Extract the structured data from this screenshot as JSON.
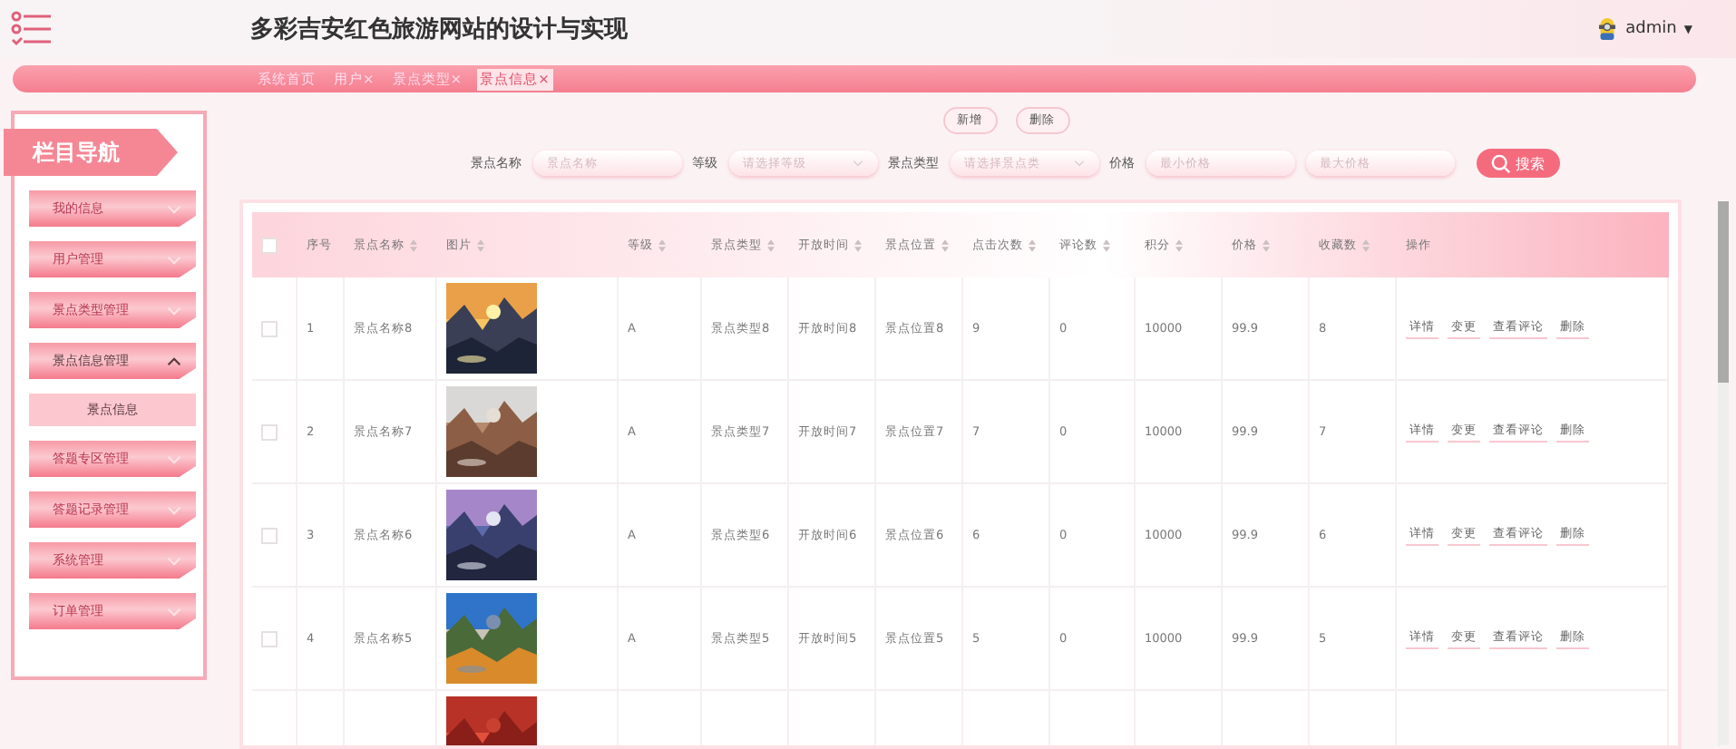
{
  "header": {
    "title": "多彩吉安红色旅游网站的设计与实现",
    "user": "admin",
    "caret": "▼"
  },
  "tabs": [
    {
      "label": "系统首页",
      "selected": false
    },
    {
      "label": "用户",
      "close": "×",
      "selected": false
    },
    {
      "label": "景点类型",
      "close": "×",
      "selected": false
    },
    {
      "label": "景点信息",
      "close": "×",
      "selected": true
    }
  ],
  "sidebar": {
    "title": "栏目导航",
    "items": [
      {
        "label": "我的信息",
        "expanded": false
      },
      {
        "label": "用户管理",
        "expanded": false
      },
      {
        "label": "景点类型管理",
        "expanded": false
      },
      {
        "label": "景点信息管理",
        "expanded": true,
        "children": [
          {
            "label": "景点信息",
            "selected": true
          }
        ]
      },
      {
        "label": "答题专区管理",
        "expanded": false
      },
      {
        "label": "答题记录管理",
        "expanded": false
      },
      {
        "label": "系统管理",
        "expanded": false
      },
      {
        "label": "订单管理",
        "expanded": false
      }
    ]
  },
  "actions": [
    "新增",
    "删除"
  ],
  "filters": [
    {
      "kind": "text",
      "label": "景点名称",
      "placeholder": "景点名称"
    },
    {
      "kind": "select",
      "label": "等级",
      "placeholder": "请选择等级"
    },
    {
      "kind": "select",
      "label": "景点类型",
      "placeholder": "请选择景点类"
    },
    {
      "kind": "text",
      "label": "价格",
      "placeholder": "最小价格"
    },
    {
      "kind": "text",
      "placeholder": "最大价格"
    }
  ],
  "search_button": "搜索",
  "table": {
    "all_checked": false,
    "columns": [
      {
        "label": "序号",
        "sortable": false
      },
      {
        "label": "景点名称",
        "sortable": true
      },
      {
        "label": "图片",
        "sortable": true
      },
      {
        "label": "等级",
        "sortable": true
      },
      {
        "label": "景点类型",
        "sortable": true
      },
      {
        "label": "开放时间",
        "sortable": true
      },
      {
        "label": "景点位置",
        "sortable": true
      },
      {
        "label": "点击次数",
        "sortable": true
      },
      {
        "label": "评论数",
        "sortable": true
      },
      {
        "label": "积分",
        "sortable": true
      },
      {
        "label": "价格",
        "sortable": true
      },
      {
        "label": "收藏数",
        "sortable": true
      },
      {
        "label": "操作",
        "sortable": false
      }
    ],
    "rows": [
      {
        "checked": false,
        "cells": [
          "1",
          "景点名称8",
          "A",
          "景点类型8",
          "开放时间8",
          "景点位置8",
          "9",
          "0",
          "10000",
          "99.9",
          "8"
        ],
        "image": {
          "kind": "picture"
        },
        "actions": [
          "详情",
          "变更",
          "查看评论",
          "删除"
        ]
      },
      {
        "checked": false,
        "cells": [
          "2",
          "景点名称7",
          "A",
          "景点类型7",
          "开放时间7",
          "景点位置7",
          "7",
          "0",
          "10000",
          "99.9",
          "7"
        ],
        "image": {
          "kind": "picture"
        },
        "actions": [
          "详情",
          "变更",
          "查看评论",
          "删除"
        ]
      },
      {
        "checked": false,
        "cells": [
          "3",
          "景点名称6",
          "A",
          "景点类型6",
          "开放时间6",
          "景点位置6",
          "6",
          "0",
          "10000",
          "99.9",
          "6"
        ],
        "image": {
          "kind": "picture"
        },
        "actions": [
          "详情",
          "变更",
          "查看评论",
          "删除"
        ]
      },
      {
        "checked": false,
        "cells": [
          "4",
          "景点名称5",
          "A",
          "景点类型5",
          "开放时间5",
          "景点位置5",
          "5",
          "0",
          "10000",
          "99.9",
          "5"
        ],
        "image": {
          "kind": "picture"
        },
        "actions": [
          "详情",
          "变更",
          "查看评论",
          "删除"
        ]
      },
      {
        "image": {
          "kind": "picture"
        }
      }
    ]
  }
}
